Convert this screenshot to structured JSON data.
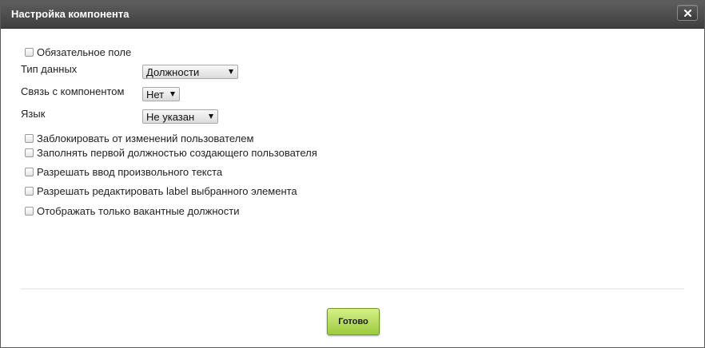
{
  "dialog": {
    "title": "Настройка компонента",
    "close_icon": "close-icon"
  },
  "form": {
    "required_field_label": "Обязательное поле",
    "data_type": {
      "label": "Тип данных",
      "value": "Должности"
    },
    "link": {
      "label": "Связь с компонентом",
      "value": "Нет"
    },
    "language": {
      "label": "Язык",
      "value": "Не указан"
    },
    "options": [
      "Заблокировать от изменений пользователем",
      "Заполнять первой должностью создающего пользователя",
      "Разрешать ввод произвольного текста",
      "Разрешать редактировать label выбранного элемента",
      "Отображать только вакантные должности"
    ]
  },
  "footer": {
    "done_label": "Готово",
    "done_color": "#9ccb3c"
  },
  "colors": {
    "titlebar": "#4a4a4a",
    "text": "#222222"
  }
}
